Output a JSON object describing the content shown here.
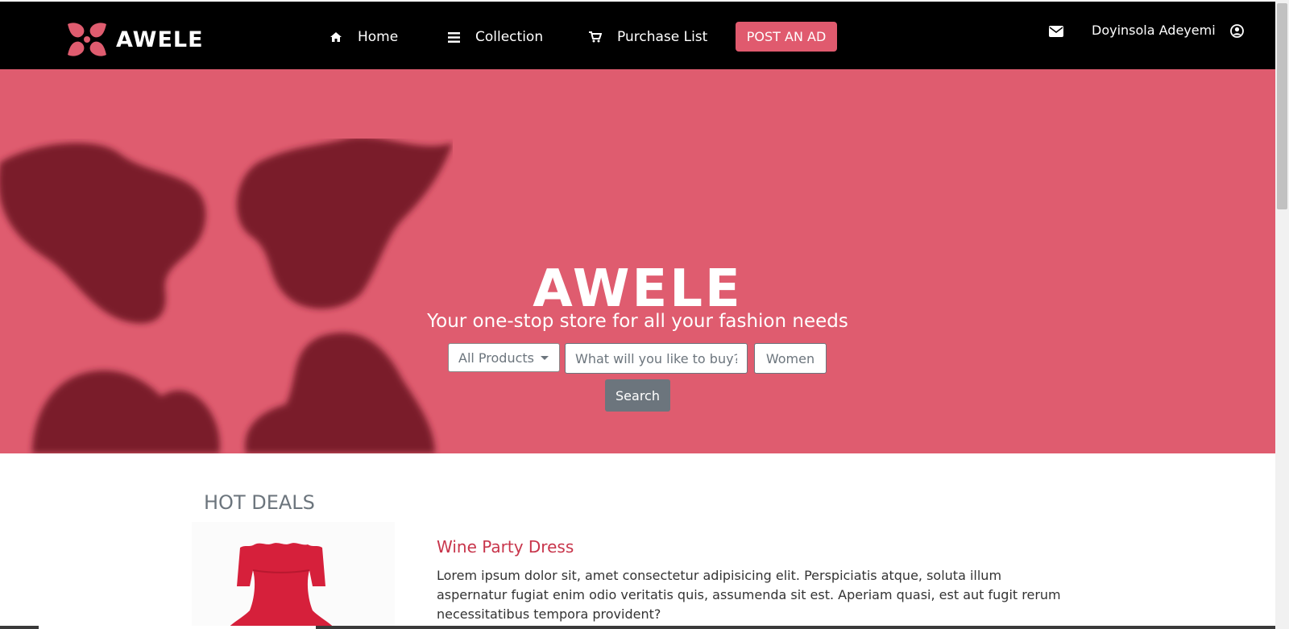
{
  "navbar": {
    "brand": "AWELE",
    "items": [
      {
        "label": "Home",
        "icon": "home-icon"
      },
      {
        "label": "Collection",
        "icon": "bars-icon"
      },
      {
        "label": "Purchase List",
        "icon": "cart-icon"
      }
    ],
    "post_ad_label": "POST AN AD",
    "user_name": "Doyinsola Adeyemi"
  },
  "hero": {
    "title": "AWELE",
    "subtitle": "Your one-stop store for all your fashion needs",
    "category_selected": "All Products",
    "search_placeholder": "What will you like to buy?",
    "gender_selected": "Women",
    "search_label": "Search"
  },
  "content": {
    "section_title": "HOT DEALS",
    "product": {
      "name": "Wine Party Dress",
      "description": "Lorem ipsum dolor sit, amet consectetur adipisicing elit. Perspiciatis atque, soluta illum aspernatur fugiat enim odio veritatis quis, assumenda sit est. Aperiam quasi, est aut fugit rerum necessitatibus tempora provident?"
    }
  },
  "colors": {
    "navbar_bg": "#000000",
    "hero_bg": "#df5c6f",
    "hero_art": "#7a1b2c",
    "accent": "#e05a6e",
    "product_name": "#c8354b",
    "muted": "#6c757d"
  }
}
